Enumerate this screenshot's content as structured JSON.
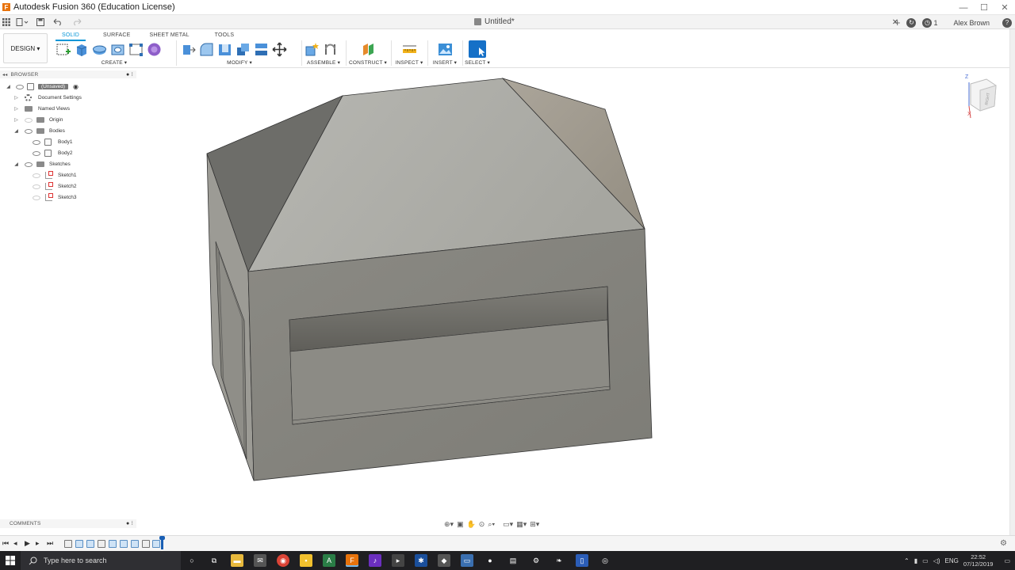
{
  "window": {
    "title": "Autodesk Fusion 360 (Education License)",
    "logo_letter": "F",
    "controls": [
      "—",
      "☐",
      "✕"
    ]
  },
  "quick_access": {
    "document_title": "Untitled*",
    "close_tab": "✕",
    "notifications_count": "1",
    "user_name": "Alex Brown",
    "help": "?"
  },
  "ribbon": {
    "workspace": "DESIGN ▾",
    "tabs": [
      "SOLID",
      "SURFACE",
      "SHEET METAL",
      "TOOLS"
    ],
    "active_tab": "SOLID",
    "groups": {
      "create": "CREATE ▾",
      "modify": "MODIFY ▾",
      "assemble": "ASSEMBLE ▾",
      "construct": "CONSTRUCT ▾",
      "inspect": "INSPECT ▾",
      "insert": "INSERT ▾",
      "select": "SELECT ▾"
    }
  },
  "browser": {
    "header": "BROWSER",
    "root": "(Unsaved)",
    "items": [
      {
        "label": "Document Settings"
      },
      {
        "label": "Named Views"
      },
      {
        "label": "Origin"
      },
      {
        "label": "Bodies"
      },
      {
        "label": "Body1"
      },
      {
        "label": "Body2"
      },
      {
        "label": "Sketches"
      },
      {
        "label": "Sketch1"
      },
      {
        "label": "Sketch2"
      },
      {
        "label": "Sketch3"
      }
    ]
  },
  "viewcube": {
    "axis_z": "Z",
    "axis_x": "X",
    "face_label": "RIGHT"
  },
  "comments": {
    "header": "COMMENTS"
  },
  "taskbar": {
    "search_placeholder": "Type here to search",
    "time": "22:52",
    "date": "07/12/2019",
    "tray_lang": "ENG"
  },
  "colors": {
    "accent": "#0696d7",
    "model_face": "#a8a8a0",
    "taskbar": "#1f1f22"
  }
}
